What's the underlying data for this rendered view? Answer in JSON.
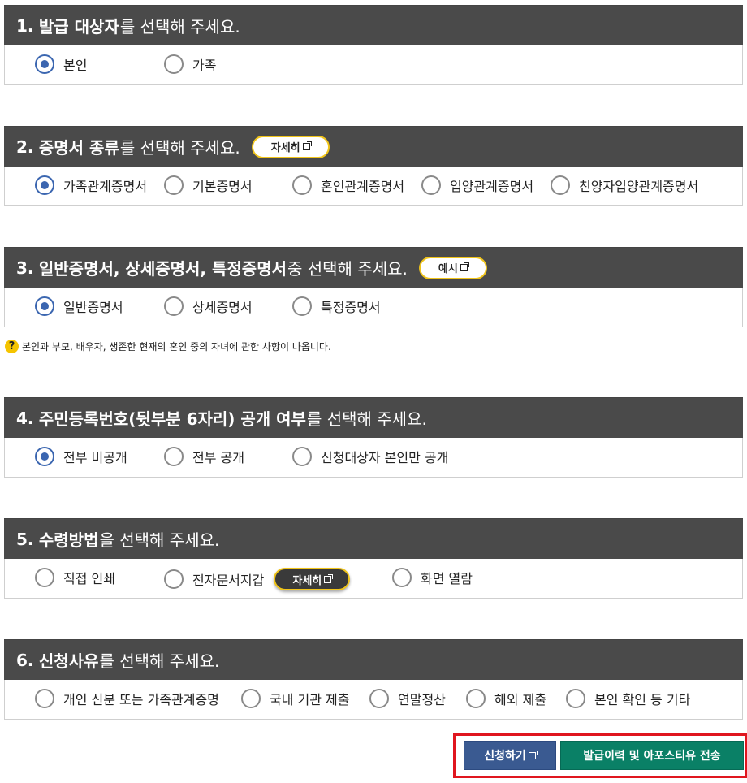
{
  "sections": [
    {
      "number": "1.",
      "title_bold": "발급 대상자",
      "title_rest": "를 선택해 주세요.",
      "options": [
        {
          "label": "본인",
          "selected": true
        },
        {
          "label": "가족",
          "selected": false
        }
      ]
    },
    {
      "number": "2.",
      "title_bold": "증명서 종류",
      "title_rest": "를 선택해 주세요.",
      "badge": "자세히",
      "options": [
        {
          "label": "가족관계증명서",
          "selected": true
        },
        {
          "label": "기본증명서",
          "selected": false
        },
        {
          "label": "혼인관계증명서",
          "selected": false
        },
        {
          "label": "입양관계증명서",
          "selected": false
        },
        {
          "label": "친양자입양관계증명서",
          "selected": false
        }
      ]
    },
    {
      "number": "3.",
      "title_bold": "일반증명서, 상세증명서, 특정증명서",
      "title_rest": " 중 선택해 주세요.",
      "badge": "예시",
      "options": [
        {
          "label": "일반증명서",
          "selected": true
        },
        {
          "label": "상세증명서",
          "selected": false
        },
        {
          "label": "특정증명서",
          "selected": false
        }
      ]
    },
    {
      "number": "4.",
      "title_bold": "주민등록번호(뒷부분 6자리) 공개 여부",
      "title_rest": "를 선택해 주세요.",
      "options": [
        {
          "label": "전부 비공개",
          "selected": true
        },
        {
          "label": "전부 공개",
          "selected": false
        },
        {
          "label": "신청대상자 본인만 공개",
          "selected": false
        }
      ]
    },
    {
      "number": "5.",
      "title_bold": "수령방법",
      "title_rest": "을 선택해 주세요.",
      "inline_badge": "자세히",
      "options": [
        {
          "label": "직접 인쇄",
          "selected": false
        },
        {
          "label": "전자문서지갑",
          "selected": false
        },
        {
          "label": "화면 열람",
          "selected": false
        }
      ]
    },
    {
      "number": "6.",
      "title_bold": "신청사유",
      "title_rest": "를 선택해 주세요.",
      "options": [
        {
          "label": "개인 신분 또는 가족관계증명",
          "selected": false
        },
        {
          "label": "국내 기관 제출",
          "selected": false
        },
        {
          "label": "연말정산",
          "selected": false
        },
        {
          "label": "해외 제출",
          "selected": false
        },
        {
          "label": "본인 확인 등 기타",
          "selected": false
        }
      ]
    }
  ],
  "note": "본인과 부모, 배우자, 생존한 현재의 혼인 중의 자녀에 관한 사항이 나옵니다.",
  "note_icon": "?",
  "actions": {
    "apply_label": "신청하기",
    "history_label": "발급이력 및 아포스티유 전송"
  }
}
